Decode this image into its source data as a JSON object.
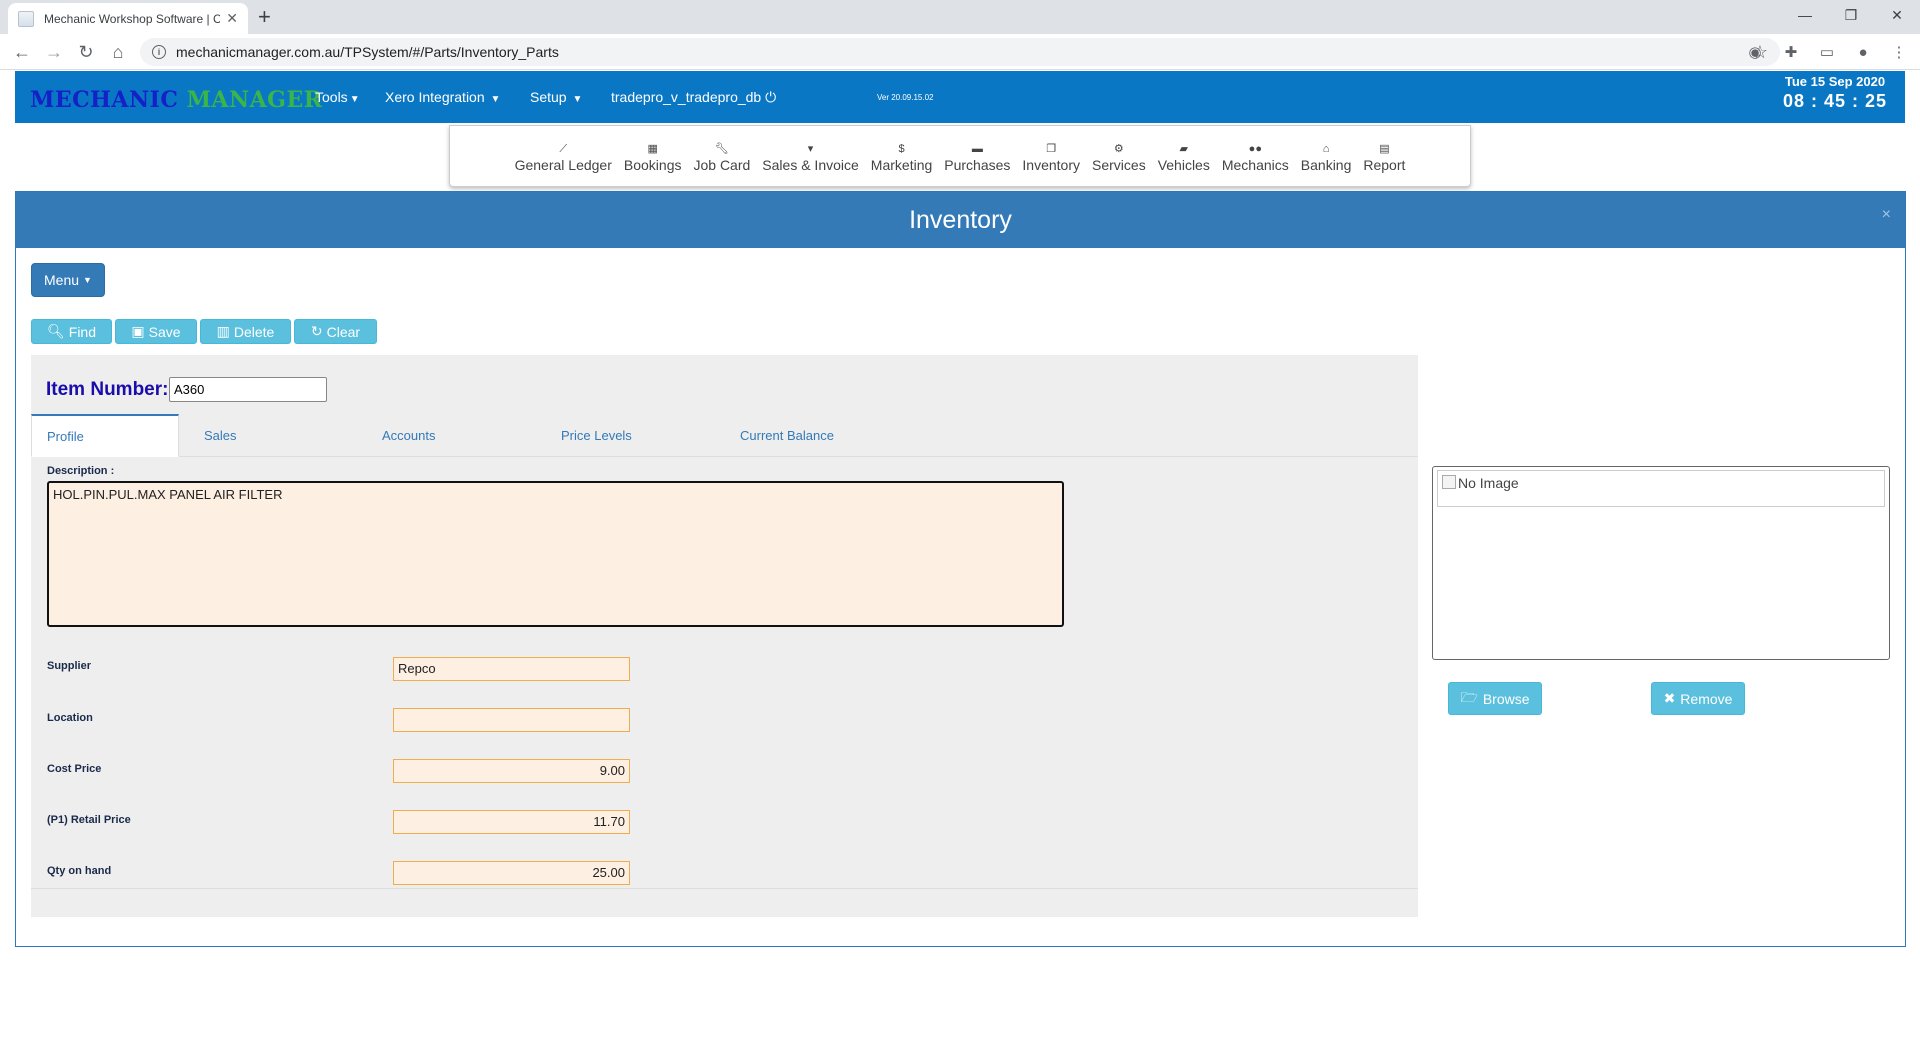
{
  "browser": {
    "tab_title": "Mechanic Workshop Software | C",
    "new_tab": "+",
    "url": "mechanicmanager.com.au/TPSystem/#/Parts/Inventory_Parts"
  },
  "header": {
    "logo_part1": "MECHANIC",
    "logo_part2": "MANAGER",
    "nav": [
      "Tools",
      "Xero Integration",
      "Setup"
    ],
    "database": "tradepro_v_tradepro_db",
    "version": "Ver 20.09.15.02",
    "date": "Tue 15 Sep 2020",
    "time": "08 : 45 : 25"
  },
  "modules": [
    {
      "label": "General Ledger",
      "icon": "chart-line-icon"
    },
    {
      "label": "Bookings",
      "icon": "calendar-icon"
    },
    {
      "label": "Job Card",
      "icon": "wrench-icon"
    },
    {
      "label": "Sales & Invoice",
      "icon": "cart-icon"
    },
    {
      "label": "Marketing",
      "icon": "dollar-icon"
    },
    {
      "label": "Purchases",
      "icon": "credit-card-icon"
    },
    {
      "label": "Inventory",
      "icon": "copy-icon"
    },
    {
      "label": "Services",
      "icon": "cogs-icon"
    },
    {
      "label": "Vehicles",
      "icon": "car-icon"
    },
    {
      "label": "Mechanics",
      "icon": "users-icon"
    },
    {
      "label": "Banking",
      "icon": "bank-icon"
    },
    {
      "label": "Report",
      "icon": "file-icon"
    }
  ],
  "panel": {
    "title": "Inventory",
    "close": "×",
    "menu_label": "Menu",
    "actions": {
      "find": "Find",
      "save": "Save",
      "delete": "Delete",
      "clear": "Clear"
    }
  },
  "form": {
    "item_number_label": "Item Number:",
    "item_number": "A360",
    "tabs": [
      "Profile",
      "Sales",
      "Accounts",
      "Price Levels",
      "Current Balance"
    ],
    "active_tab": "Profile",
    "description_label": "Description :",
    "description": "HOL.PIN.PUL.MAX PANEL AIR FILTER",
    "fields": {
      "supplier": {
        "label": "Supplier",
        "value": "Repco"
      },
      "location": {
        "label": "Location",
        "value": ""
      },
      "cost_price": {
        "label": "Cost Price",
        "value": "9.00"
      },
      "retail_price": {
        "label": "(P1) Retail Price",
        "value": "11.70"
      },
      "qty_on_hand": {
        "label": "Qty on hand",
        "value": "25.00"
      }
    }
  },
  "image": {
    "alt_text": "No Image",
    "browse_label": "Browse",
    "remove_label": "Remove"
  },
  "colors": {
    "header_blue": "#0a77c4",
    "panel_blue": "#337ab7",
    "info_button": "#5bc0de",
    "field_bg": "#fdefe1",
    "field_border": "#f0ad4e",
    "logo_blue": "#1420c8",
    "logo_green": "#3ab54a"
  }
}
